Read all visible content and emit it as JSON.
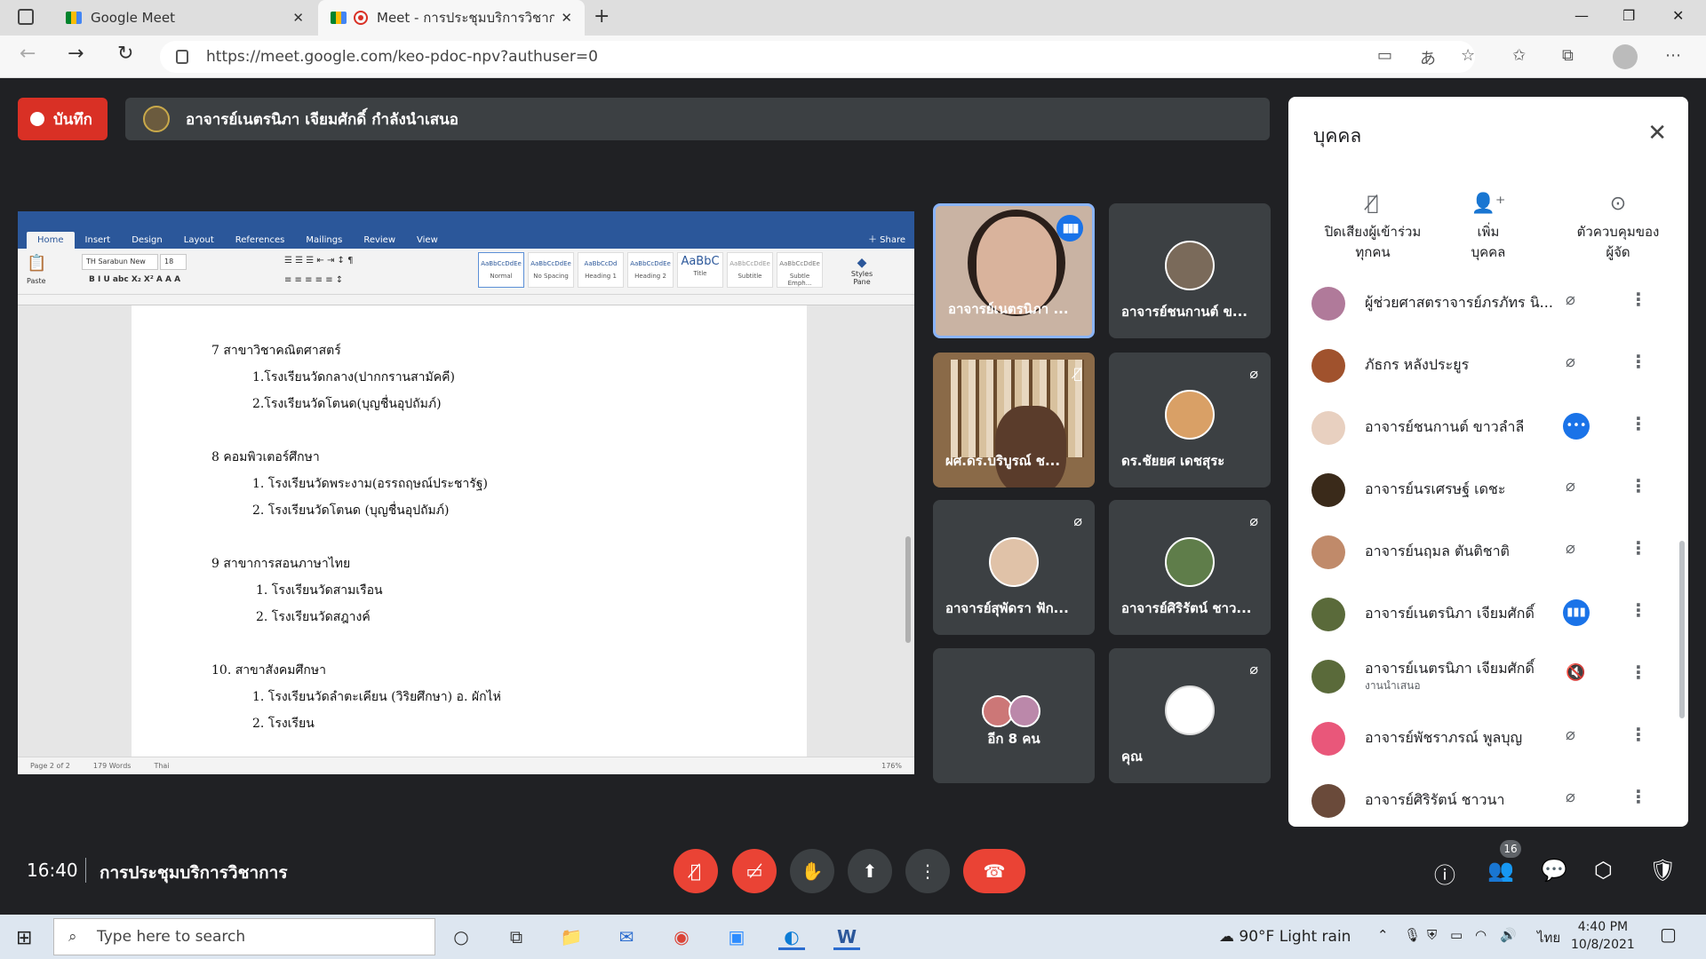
{
  "browser": {
    "tabs": [
      {
        "label": "Google Meet"
      },
      {
        "label": "Meet - การประชุมบริการวิชาการ"
      }
    ],
    "url": "https://meet.google.com/keo-pdoc-npv?authuser=0"
  },
  "meet": {
    "record_label": "บันทึก",
    "presenting_banner": "อาจารย์เนตรนิภา เจียมศักดิ์ กำลังนำเสนอ",
    "clock": "16:40",
    "meeting_name": "การประชุมบริการวิชาการ",
    "participant_count": "16"
  },
  "word": {
    "tabs": [
      "Home",
      "Insert",
      "Design",
      "Layout",
      "References",
      "Mailings",
      "Review",
      "View"
    ],
    "share_label": "Share",
    "font_name": "TH Sarabun New",
    "font_size": "18",
    "paste_label": "Paste",
    "styles_pane_label": "Styles Pane",
    "styles": [
      "Normal",
      "No Spacing",
      "Heading 1",
      "Heading 2",
      "Title",
      "Subtitle",
      "Subtle Emph..."
    ],
    "style_previews": [
      "AaBbCcDdEe",
      "AaBbCcDdEe",
      "AaBbCcDd",
      "AaBbCcDdEe",
      "AaBbC",
      "AaBbCcDdEe",
      "AaBbCcDdEe"
    ],
    "doc_lines": [
      {
        "text": "7 สาขาวิชาคณิตศาสตร์",
        "indent": 0
      },
      {
        "text": "1.โรงเรียนวัดกลาง(ปากกรานสามัคคี)",
        "indent": 1
      },
      {
        "text": "2.โรงเรียนวัดโตนด(บุญชื่นอุปถัมภ์)",
        "indent": 1
      },
      {
        "text": "",
        "indent": 0
      },
      {
        "text": "8 คอมพิวเตอร์ศึกษา",
        "indent": 0
      },
      {
        "text": "1. โรงเรียนวัดพระงาม(อรรถฤษณ์ประชารัฐ)",
        "indent": 1
      },
      {
        "text": "2. โรงเรียนวัดโตนด (บุญชื่นอุปถัมภ์)",
        "indent": 1
      },
      {
        "text": "",
        "indent": 0
      },
      {
        "text": "9 สาขาการสอนภาษาไทย",
        "indent": 0
      },
      {
        "text": "1. โรงเรียนวัดสามเรือน",
        "indent": 2
      },
      {
        "text": "2. โรงเรียนวัดสฎางค์",
        "indent": 2
      },
      {
        "text": "",
        "indent": 0
      },
      {
        "text": "10. สาขาสังคมศึกษา",
        "indent": 0
      },
      {
        "text": "1. โรงเรียนวัดลำตะเคียน (วิริยศึกษา) อ. ผักไห่",
        "indent": 1
      },
      {
        "text": "2. โรงเรียน",
        "indent": 1
      }
    ],
    "status": {
      "page": "Page 2 of 2",
      "words": "179 Words",
      "language": "Thai",
      "zoom": "176%"
    }
  },
  "tiles": [
    {
      "name": "อาจารย์เนตรนิภา ...",
      "state": "speaking"
    },
    {
      "name": "อาจารย์ชนกานต์ ข...",
      "state": "avatar"
    },
    {
      "name": "ผศ.ดร.บริบูรณ์ ช...",
      "state": "muted-video"
    },
    {
      "name": "ดร.ชัยยศ เดชสุระ",
      "state": "muted"
    },
    {
      "name": "อาจารย์สุพัดรา ฟัก...",
      "state": "muted"
    },
    {
      "name": "อาจารย์ศิริรัตน์ ชาว...",
      "state": "muted"
    },
    {
      "name": "อีก 8 คน",
      "state": "group"
    },
    {
      "name": "คุณ",
      "state": "muted"
    }
  ],
  "panel": {
    "title": "บุคคล",
    "actions": [
      {
        "label1": "ปิดเสียงผู้เข้าร่วม",
        "label2": "ทุกคน"
      },
      {
        "label1": "เพิ่ม",
        "label2": "บุคคล"
      },
      {
        "label1": "ตัวควบคุมของ",
        "label2": "ผู้จัด"
      }
    ],
    "people": [
      {
        "name": "ผู้ช่วยศาสตราจารย์ภรภัทร นิ...",
        "sub": "",
        "mic": "muted"
      },
      {
        "name": "ภัธกร หลังประยูร",
        "sub": "",
        "mic": "muted"
      },
      {
        "name": "อาจารย์ชนกานต์ ขาวลำลี",
        "sub": "",
        "mic": "active-dots"
      },
      {
        "name": "อาจารย์นรเศรษฐ์ เดชะ",
        "sub": "",
        "mic": "muted"
      },
      {
        "name": "อาจารย์นฤมล ตันติชาติ",
        "sub": "",
        "mic": "muted"
      },
      {
        "name": "อาจารย์เนตรนิภา เจียมศักดิ์",
        "sub": "",
        "mic": "active"
      },
      {
        "name": "อาจารย์เนตรนิภา เจียมศักดิ์",
        "sub": "งานนำเสนอ",
        "mic": "muted-audio"
      },
      {
        "name": "อาจารย์พัชราภรณ์ พูลบุญ",
        "sub": "",
        "mic": "muted"
      },
      {
        "name": "อาจารย์ศิริรัตน์ ชาวนา",
        "sub": "",
        "mic": "muted"
      }
    ]
  },
  "taskbar": {
    "search_placeholder": "Type here to search",
    "weather": "90°F  Light rain",
    "lang": "ไทย",
    "time": "4:40 PM",
    "date": "10/8/2021"
  },
  "colors": {
    "meet_bg": "#202124",
    "tile_bg": "#3c4043",
    "danger": "#ea4335",
    "accent": "#1a73e8",
    "word_blue": "#2b579a"
  }
}
